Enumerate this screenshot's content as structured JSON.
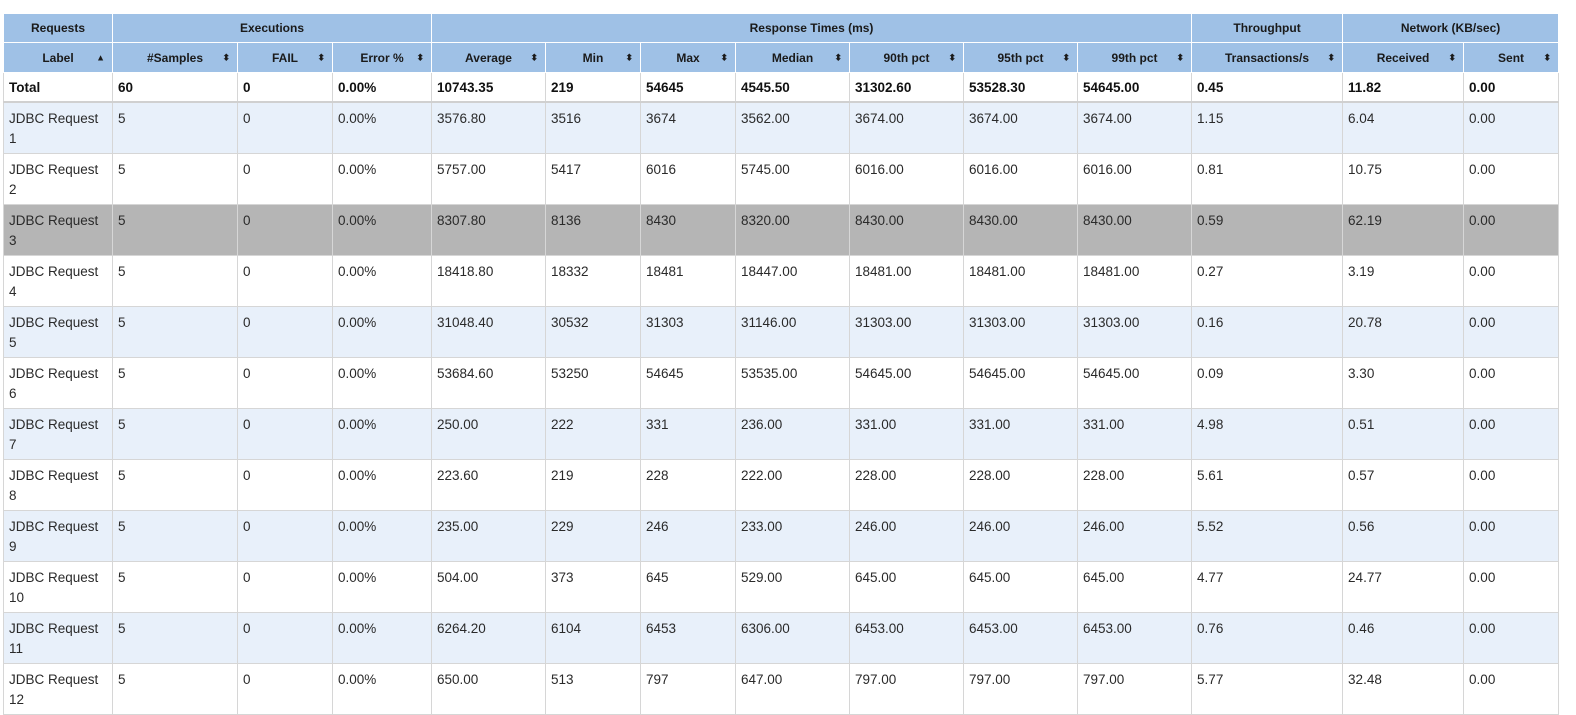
{
  "group_headers": [
    {
      "label": "Requests",
      "span": 1
    },
    {
      "label": "Executions",
      "span": 3
    },
    {
      "label": "Response Times (ms)",
      "span": 7
    },
    {
      "label": "Throughput",
      "span": 1
    },
    {
      "label": "Network (KB/sec)",
      "span": 2
    }
  ],
  "columns": [
    {
      "label": "Label",
      "sort": "▲"
    },
    {
      "label": "#Samples",
      "sort": "⬍"
    },
    {
      "label": "FAIL",
      "sort": "⬍"
    },
    {
      "label": "Error %",
      "sort": "⬍"
    },
    {
      "label": "Average",
      "sort": "⬍"
    },
    {
      "label": "Min",
      "sort": "⬍"
    },
    {
      "label": "Max",
      "sort": "⬍"
    },
    {
      "label": "Median",
      "sort": "⬍"
    },
    {
      "label": "90th pct",
      "sort": "⬍"
    },
    {
      "label": "95th pct",
      "sort": "⬍"
    },
    {
      "label": "99th pct",
      "sort": "⬍"
    },
    {
      "label": "Transactions/s",
      "sort": "⬍"
    },
    {
      "label": "Received",
      "sort": "⬍"
    },
    {
      "label": "Sent",
      "sort": "⬍"
    }
  ],
  "total": [
    "Total",
    "60",
    "0",
    "0.00%",
    "10743.35",
    "219",
    "54645",
    "4545.50",
    "31302.60",
    "53528.30",
    "54645.00",
    "0.45",
    "11.82",
    "0.00"
  ],
  "rows": [
    [
      "JDBC Request 1",
      "5",
      "0",
      "0.00%",
      "3576.80",
      "3516",
      "3674",
      "3562.00",
      "3674.00",
      "3674.00",
      "3674.00",
      "1.15",
      "6.04",
      "0.00"
    ],
    [
      "JDBC Request 2",
      "5",
      "0",
      "0.00%",
      "5757.00",
      "5417",
      "6016",
      "5745.00",
      "6016.00",
      "6016.00",
      "6016.00",
      "0.81",
      "10.75",
      "0.00"
    ],
    [
      "JDBC Request 3",
      "5",
      "0",
      "0.00%",
      "8307.80",
      "8136",
      "8430",
      "8320.00",
      "8430.00",
      "8430.00",
      "8430.00",
      "0.59",
      "62.19",
      "0.00"
    ],
    [
      "JDBC Request 4",
      "5",
      "0",
      "0.00%",
      "18418.80",
      "18332",
      "18481",
      "18447.00",
      "18481.00",
      "18481.00",
      "18481.00",
      "0.27",
      "3.19",
      "0.00"
    ],
    [
      "JDBC Request 5",
      "5",
      "0",
      "0.00%",
      "31048.40",
      "30532",
      "31303",
      "31146.00",
      "31303.00",
      "31303.00",
      "31303.00",
      "0.16",
      "20.78",
      "0.00"
    ],
    [
      "JDBC Request 6",
      "5",
      "0",
      "0.00%",
      "53684.60",
      "53250",
      "54645",
      "53535.00",
      "54645.00",
      "54645.00",
      "54645.00",
      "0.09",
      "3.30",
      "0.00"
    ],
    [
      "JDBC Request 7",
      "5",
      "0",
      "0.00%",
      "250.00",
      "222",
      "331",
      "236.00",
      "331.00",
      "331.00",
      "331.00",
      "4.98",
      "0.51",
      "0.00"
    ],
    [
      "JDBC Request 8",
      "5",
      "0",
      "0.00%",
      "223.60",
      "219",
      "228",
      "222.00",
      "228.00",
      "228.00",
      "228.00",
      "5.61",
      "0.57",
      "0.00"
    ],
    [
      "JDBC Request 9",
      "5",
      "0",
      "0.00%",
      "235.00",
      "229",
      "246",
      "233.00",
      "246.00",
      "246.00",
      "246.00",
      "5.52",
      "0.56",
      "0.00"
    ],
    [
      "JDBC Request 10",
      "5",
      "0",
      "0.00%",
      "504.00",
      "373",
      "645",
      "529.00",
      "645.00",
      "645.00",
      "645.00",
      "4.77",
      "24.77",
      "0.00"
    ],
    [
      "JDBC Request 11",
      "5",
      "0",
      "0.00%",
      "6264.20",
      "6104",
      "6453",
      "6306.00",
      "6453.00",
      "6453.00",
      "6453.00",
      "0.76",
      "0.46",
      "0.00"
    ],
    [
      "JDBC Request 12",
      "5",
      "0",
      "0.00%",
      "650.00",
      "513",
      "797",
      "647.00",
      "797.00",
      "797.00",
      "797.00",
      "5.77",
      "32.48",
      "0.00"
    ]
  ],
  "selected_row": 2,
  "colors": {
    "header_bg": "#9fc1e6",
    "row_alt_bg": "#e8f0fa",
    "row_selected_bg": "#b5b5b5",
    "border": "#d6d6d6"
  }
}
